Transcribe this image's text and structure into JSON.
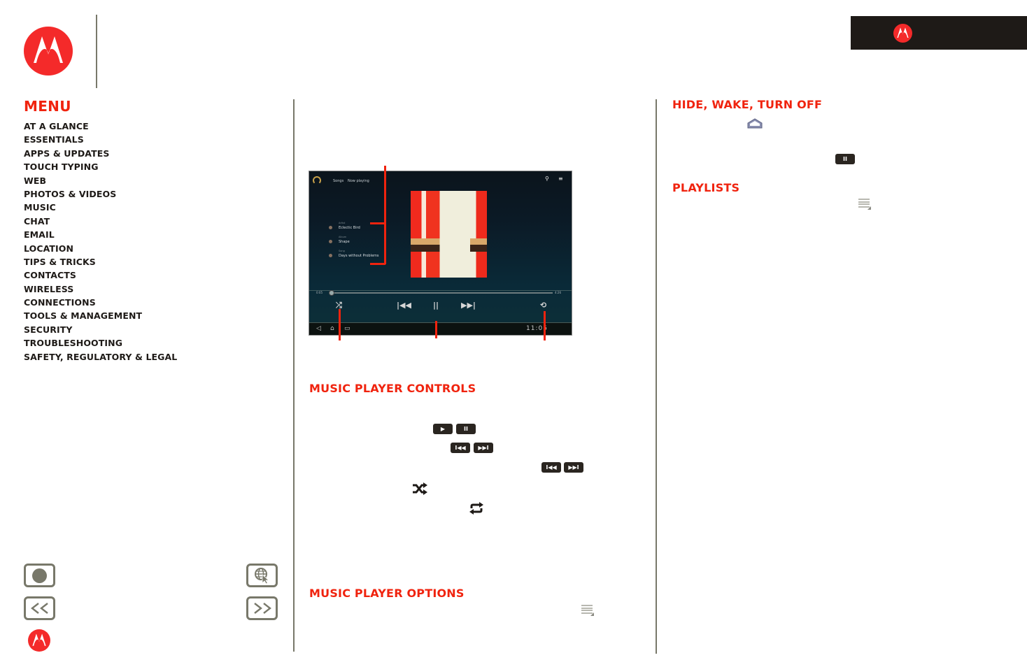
{
  "header": {
    "logo_name": "motorola-logo"
  },
  "menu": {
    "title": "MENU",
    "items": [
      "AT A GLANCE",
      "ESSENTIALS",
      "APPS & UPDATES",
      "TOUCH TYPING",
      "WEB",
      "PHOTOS & VIDEOS",
      "MUSIC",
      "CHAT",
      "EMAIL",
      "LOCATION",
      "TIPS & TRICKS",
      "CONTACTS",
      "WIRELESS",
      "CONNECTIONS",
      "TOOLS & MANAGEMENT",
      "SECURITY",
      "TROUBLESHOOTING",
      "SAFETY, REGULATORY & LEGAL"
    ]
  },
  "nav_buttons": {
    "record": "record-icon",
    "web": "globe-cursor-icon",
    "back": "<<",
    "forward": ">>"
  },
  "device": {
    "tabs": [
      "Songs",
      "Now playing"
    ],
    "tracks": [
      {
        "label": "Artist",
        "title": "Eclectic Bird"
      },
      {
        "label": "Album",
        "title": "Shape"
      },
      {
        "label": "Song",
        "title": "Days without Problems"
      }
    ],
    "time_elapsed": "0:05",
    "time_total": "4:26",
    "clock": "11:05",
    "controls": {
      "shuffle": "⤮",
      "previous": "|◀◀",
      "pause": "||",
      "next": "▶▶|",
      "repeat": "⟲"
    },
    "nav": {
      "back": "◁",
      "home": "⌂",
      "recent": "▭"
    }
  },
  "sections": {
    "controls_title": "MUSIC PLAYER CONTROLS",
    "options_title": "MUSIC PLAYER OPTIONS",
    "hide_title": "HIDE, WAKE, TURN OFF",
    "playlists_title": "PLAYLISTS"
  },
  "inline_buttons": {
    "play": "▶",
    "pause": "II",
    "prev": "I◀◀",
    "next": "▶▶I"
  },
  "colors": {
    "accent": "#f0230e",
    "logo_red": "#f42a2a",
    "text": "#1e1a17",
    "divider": "#78786a"
  }
}
